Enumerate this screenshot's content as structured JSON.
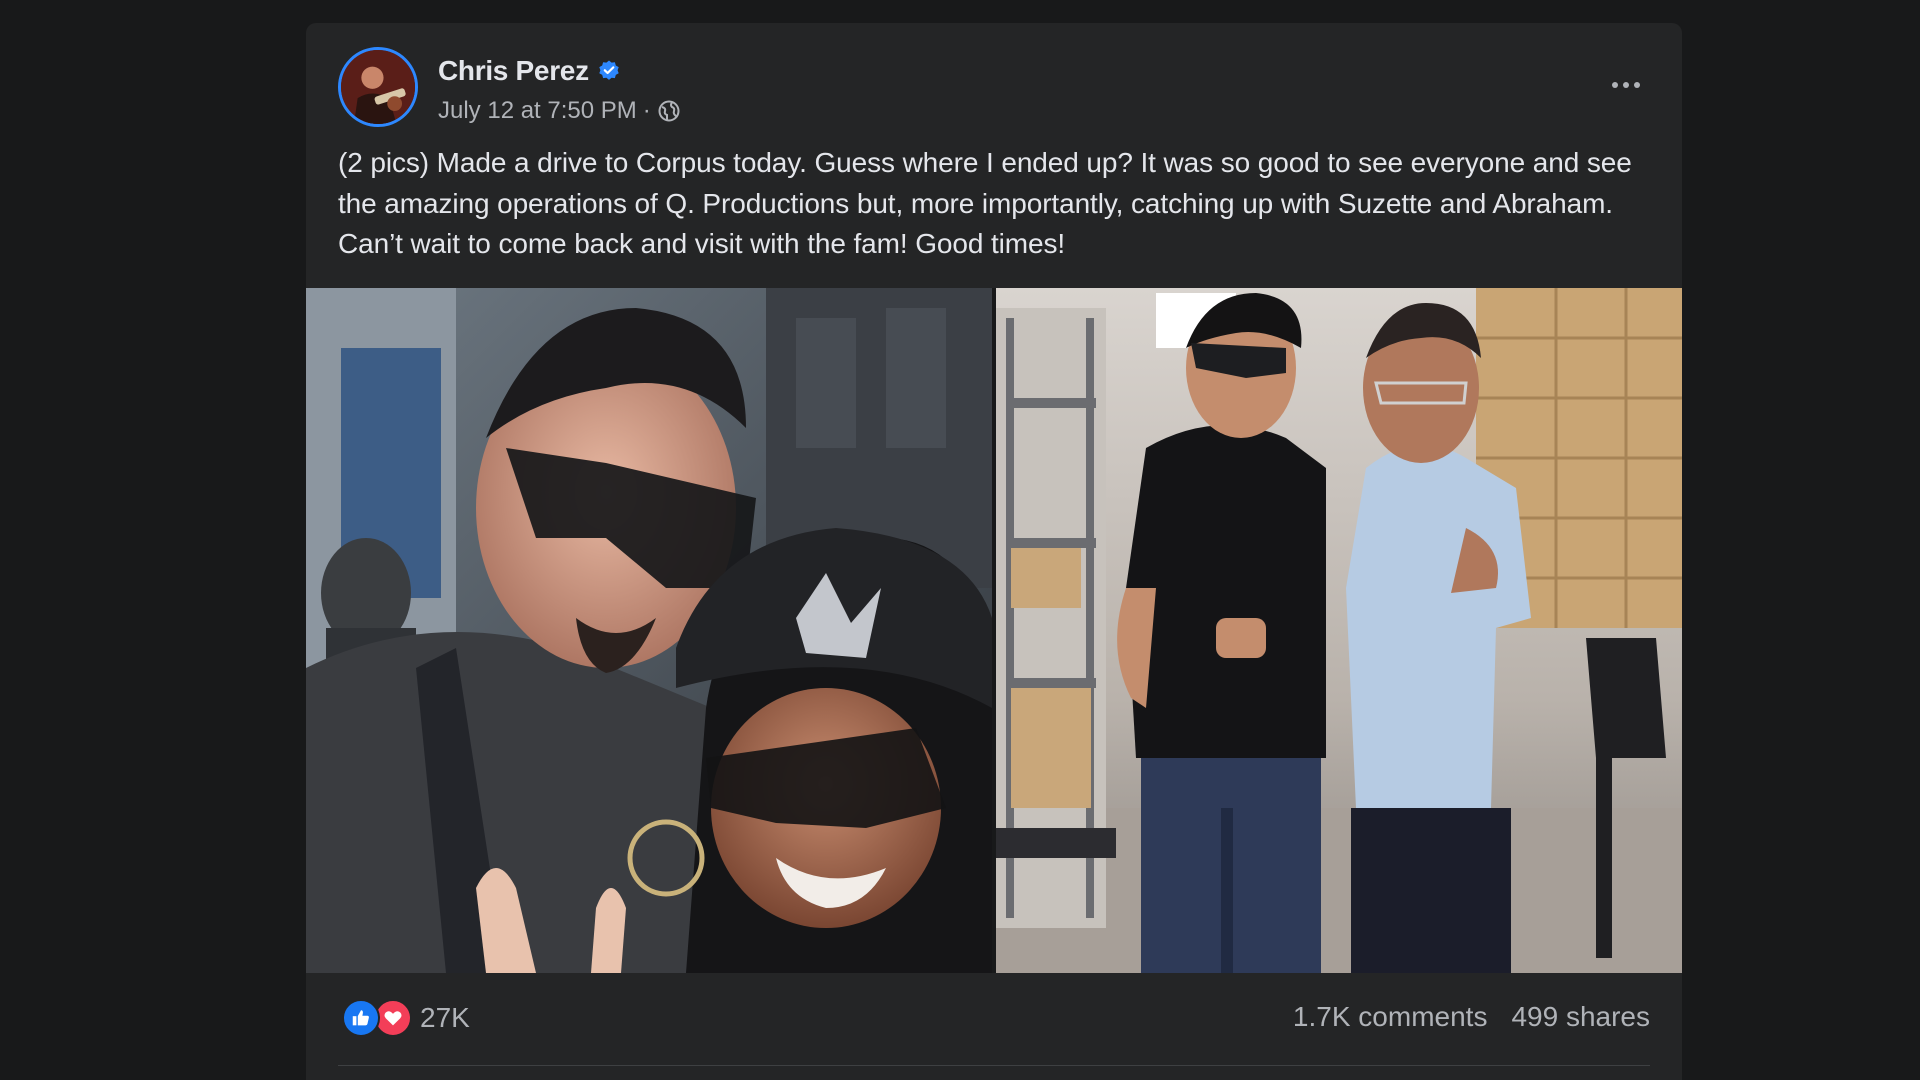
{
  "post": {
    "author": "Chris Perez",
    "verified_icon": "verified-badge-icon",
    "timestamp": "July 12 at 7:50 PM",
    "separator": "·",
    "audience_icon": "globe-icon",
    "more_icon": "more-options-icon",
    "text": "(2 pics) Made a drive to Corpus today. Guess where I ended up? It was so good to see everyone and see the amazing operations of Q. Productions but, more importantly, catching up with Suzette and Abraham. Can’t wait to come back and visit with the fam! Good times!"
  },
  "photos": [
    {
      "name": "photo-selfie"
    },
    {
      "name": "photo-warehouse"
    }
  ],
  "footer": {
    "reactions": [
      "like-icon",
      "love-icon"
    ],
    "reaction_count": "27K",
    "comments": "1.7K comments",
    "shares": "499 shares"
  },
  "colors": {
    "background": "#18191a",
    "card": "#242526",
    "primary_text": "#e4e6eb",
    "secondary_text": "#b0b3b8",
    "accent": "#2d88ff"
  }
}
